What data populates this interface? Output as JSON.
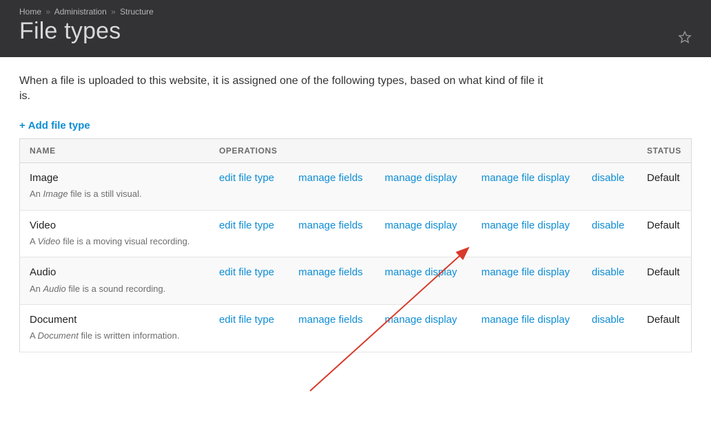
{
  "breadcrumb": {
    "items": [
      "Home",
      "Administration",
      "Structure"
    ],
    "sep": "»"
  },
  "page_title": "File types",
  "intro": "When a file is uploaded to this website, it is assigned one of the following types, based on what kind of file it is.",
  "add_link": "Add file type",
  "table": {
    "headers": {
      "name": "NAME",
      "operations": "OPERATIONS",
      "status": "STATUS"
    },
    "ops": {
      "edit": "edit file type",
      "manage_fields": "manage fields",
      "manage_display": "manage display",
      "manage_file_display": "manage file display",
      "disable": "disable"
    },
    "rows": [
      {
        "name": "Image",
        "desc_pre": "An ",
        "desc_em": "Image",
        "desc_post": " file is a still visual.",
        "status": "Default"
      },
      {
        "name": "Video",
        "desc_pre": "A ",
        "desc_em": "Video",
        "desc_post": " file is a moving visual recording.",
        "status": "Default"
      },
      {
        "name": "Audio",
        "desc_pre": "An ",
        "desc_em": "Audio",
        "desc_post": " file is a sound recording.",
        "status": "Default"
      },
      {
        "name": "Document",
        "desc_pre": "A ",
        "desc_em": "Document",
        "desc_post": " file is written information.",
        "status": "Default"
      }
    ]
  }
}
